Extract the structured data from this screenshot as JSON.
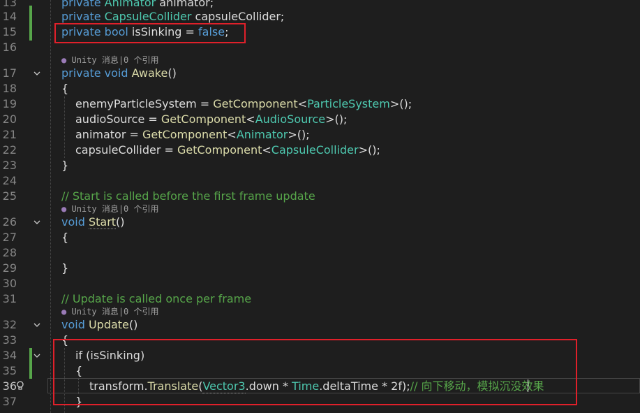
{
  "editor": {
    "line_numbers": [
      "13",
      "14",
      "15",
      "16",
      "17",
      "18",
      "19",
      "20",
      "21",
      "22",
      "23",
      "24",
      "25",
      "26",
      "27",
      "28",
      "29",
      "30",
      "31",
      "32",
      "33",
      "34",
      "35",
      "36",
      "37"
    ],
    "codelens": {
      "icon": "unity-icon",
      "text": "Unity 消息|0 个引用"
    },
    "lines": {
      "l13": {
        "t1": "private ",
        "t2": "Animator",
        "t3": " animator;"
      },
      "l14": {
        "t1": "private ",
        "t2": "CapsuleCollider",
        "t3": " capsuleCollider;"
      },
      "l15": {
        "t1": "private bool",
        "t2": " isSinking = ",
        "t3": "false",
        "t4": ";"
      },
      "l17": {
        "t1": "private void",
        "t2": " ",
        "t3": "Awake",
        "t4": "()"
      },
      "l18": {
        "t1": "{"
      },
      "l19": {
        "t1": "enemyParticleSystem = ",
        "t2": "GetComponent",
        "t3": "<",
        "t4": "ParticleSystem",
        "t5": ">();"
      },
      "l20": {
        "t1": "audioSource = ",
        "t2": "GetComponent",
        "t3": "<",
        "t4": "AudioSource",
        "t5": ">();"
      },
      "l21": {
        "t1": "animator = ",
        "t2": "GetComponent",
        "t3": "<",
        "t4": "Animator",
        "t5": ">();"
      },
      "l22": {
        "t1": "capsuleCollider = ",
        "t2": "GetComponent",
        "t3": "<",
        "t4": "CapsuleCollider",
        "t5": ">();"
      },
      "l23": {
        "t1": "}"
      },
      "l25": {
        "t1": "// Start is called before the first frame update"
      },
      "l26": {
        "t1": "void",
        "t2": " ",
        "t3": "Start",
        "t4": "()"
      },
      "l27": {
        "t1": "{"
      },
      "l29": {
        "t1": "}"
      },
      "l31": {
        "t1": "// Update is called once per frame"
      },
      "l32": {
        "t1": "void",
        "t2": " ",
        "t3": "Update",
        "t4": "()"
      },
      "l33": {
        "t1": "{"
      },
      "l34": {
        "t1": "if",
        "t2": " (isSinking)"
      },
      "l35": {
        "t1": "{"
      },
      "l36": {
        "t1": "transform.",
        "t2": "Translate",
        "t3": "(",
        "t4": "Vector3",
        "t5": ".down * ",
        "t6": "Time",
        "t7": ".deltaTime * 2f);",
        "t8": "// 向下移动，模拟沉没效果"
      },
      "l37": {
        "t1": "}"
      }
    }
  },
  "colors": {
    "background": "#1e1e1e",
    "keyword": "#569cd6",
    "type": "#4ec9b0",
    "method": "#dcdcaa",
    "comment": "#57a64a",
    "change_bar": "#57a64a",
    "highlight_box": "#e0202a"
  }
}
